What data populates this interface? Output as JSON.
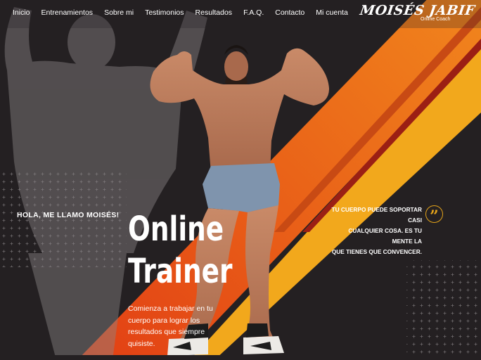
{
  "nav": {
    "items": [
      "Inicio",
      "Entrenamientos",
      "Sobre mi",
      "Testimonios",
      "Resultados",
      "F.A.Q.",
      "Contacto",
      "Mi cuenta"
    ]
  },
  "logo": {
    "name": "MOISÉS JABIF",
    "subtitle": "Online Coach"
  },
  "hero": {
    "greeting": "HOLA, ME LLAMO MOISÉS!",
    "title_line1": "Online",
    "title_line2": "Trainer",
    "description": "Comienza a trabajar en tu cuerpo para lograr los resultados que siempre quisiste."
  },
  "quote": {
    "lines": [
      "TU CUERPO PUEDE SOPORTAR CASI",
      "CUALQUIER COSA. ES TU MENTE LA",
      "QUE TIENES QUE CONVENCER."
    ],
    "icon": "quote-icon",
    "icon_glyph": "”"
  },
  "colors": {
    "background": "#242022",
    "orange": "#e86a17",
    "yellow": "#f2a81c",
    "red": "#8c1f15",
    "accent_gold": "#e4a31a"
  }
}
